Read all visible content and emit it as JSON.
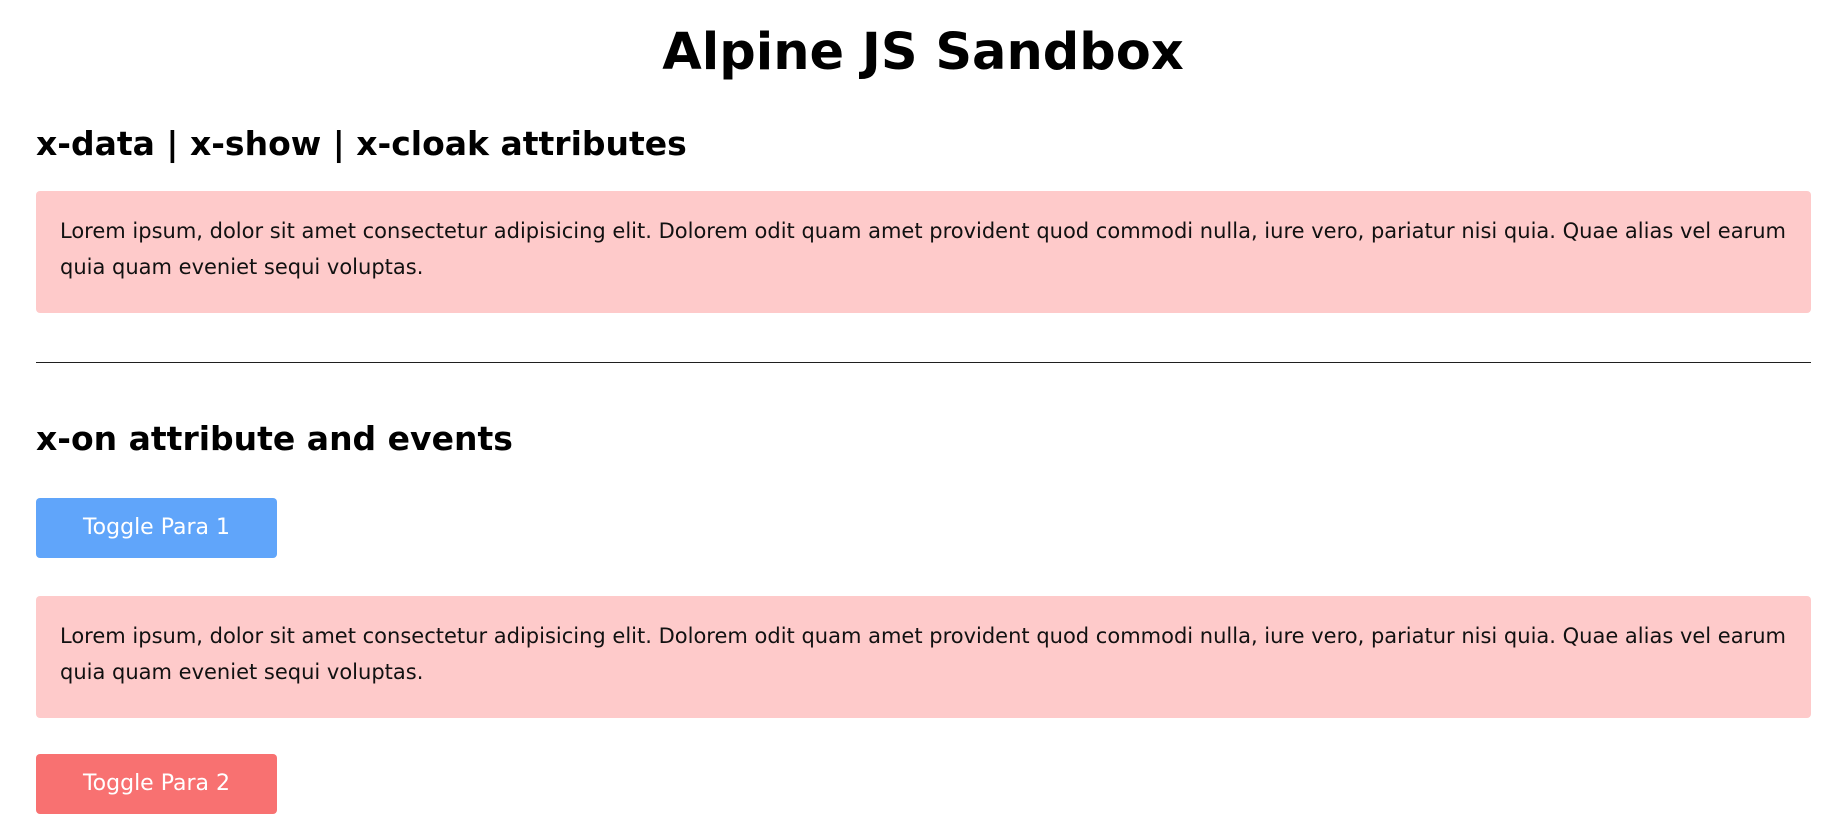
{
  "page": {
    "title": "Alpine JS Sandbox"
  },
  "section_xdata": {
    "heading": "x-data | x-show | x-cloak attributes",
    "paragraph": "Lorem ipsum, dolor sit amet consectetur adipisicing elit. Dolorem odit quam amet provident quod commodi nulla, iure vero, pariatur nisi quia. Quae alias vel earum quia quam eveniet sequi voluptas."
  },
  "section_xon": {
    "heading": "x-on attribute and events",
    "toggle_para_1_label": "Toggle Para 1",
    "paragraph": "Lorem ipsum, dolor sit amet consectetur adipisicing elit. Dolorem odit quam amet provident quod commodi nulla, iure vero, pariatur nisi quia. Quae alias vel earum quia quam eveniet sequi voluptas.",
    "toggle_para_2_label": "Toggle Para 2"
  },
  "colors": {
    "paragraph_background": "#fecaca",
    "toggle_para_1_background": "#60a5fa",
    "toggle_para_2_background": "#f87171",
    "button_text": "#ffffff"
  }
}
